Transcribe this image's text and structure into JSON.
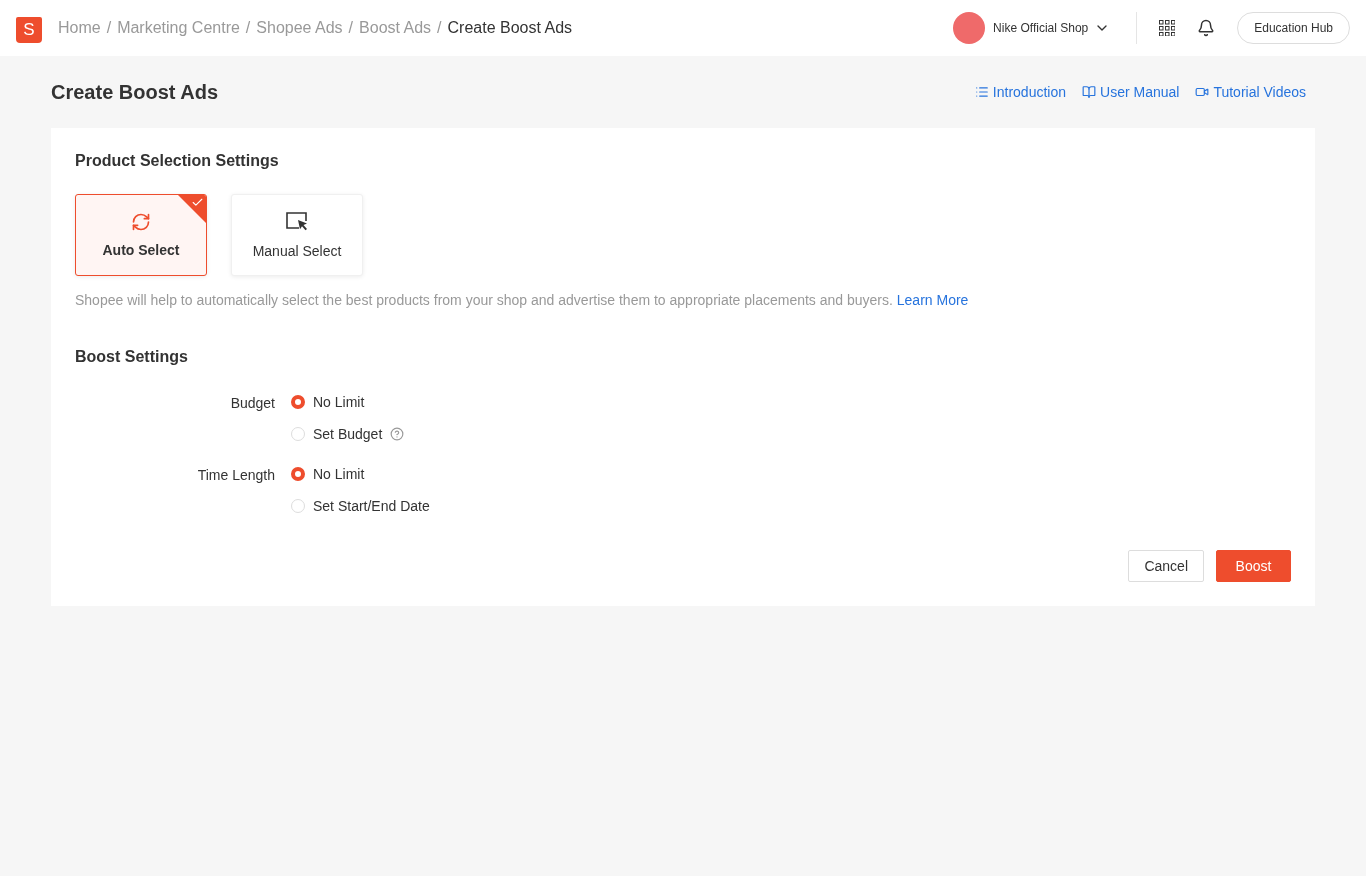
{
  "header": {
    "logo_letter": "S",
    "separator": "/",
    "breadcrumbs": [
      {
        "label": "Home",
        "selected": false
      },
      {
        "label": "Marketing Centre",
        "selected": false
      },
      {
        "label": "Shopee Ads",
        "selected": false
      },
      {
        "label": "Boost Ads",
        "selected": false
      },
      {
        "label": "Create Boost Ads",
        "selected": true
      }
    ],
    "shop": "Nike Official Shop",
    "button": "Education Hub"
  },
  "page": {
    "title": "Create Boost Ads",
    "links": [
      {
        "kind": "list",
        "label": "Introduction"
      },
      {
        "kind": "book",
        "label": "User Manual"
      },
      {
        "kind": "video",
        "label": "Tutorial Videos"
      }
    ]
  },
  "product_selection": {
    "title": "Product Selection Settings",
    "options": [
      {
        "kind": "auto",
        "label": "Auto Select",
        "selected": true
      },
      {
        "kind": "manual",
        "label": "Manual Select",
        "selected": false
      }
    ],
    "description": "Shopee will help to automatically select the best products from your shop and advertise them to appropriate placements and buyers.",
    "link": "Learn More"
  },
  "boost_settings": {
    "title": "Boost Settings",
    "groups": [
      {
        "label": "Budget",
        "options": [
          {
            "label": "No Limit",
            "selected": true,
            "help": false
          },
          {
            "label": "Set Budget",
            "selected": false,
            "help": true
          }
        ]
      },
      {
        "label": "Time Length",
        "options": [
          {
            "label": "No Limit",
            "selected": true,
            "help": false
          },
          {
            "label": "Set Start/End Date",
            "selected": false,
            "help": false
          }
        ]
      }
    ]
  },
  "actions": [
    {
      "kind": "secondary",
      "label": "Cancel"
    },
    {
      "kind": "primary",
      "label": "Boost"
    }
  ]
}
